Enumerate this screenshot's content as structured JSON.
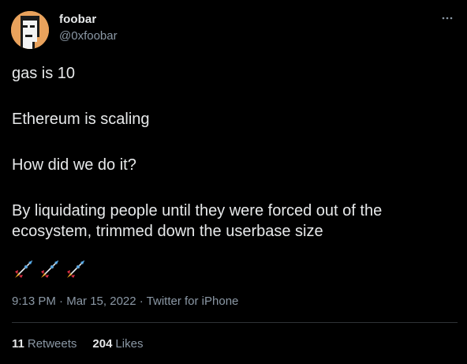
{
  "tweet": {
    "author": {
      "name": "foobar",
      "handle": "@0xfoobar",
      "avatar_icon": "pixel-punk-avatar-icon"
    },
    "more_icon": "more-horizontal-icon",
    "paragraphs": [
      "gas is 10",
      "Ethereum is scaling",
      "How did we do it?",
      "By liquidating people until they were forced out of the ecosystem, trimmed down the userbase size"
    ],
    "emojis": [
      "rocket-icon",
      "rocket-icon",
      "rocket-icon"
    ],
    "meta": {
      "time": "9:13 PM",
      "separator1": " · ",
      "date": "Mar 15, 2022",
      "separator2": " · ",
      "source": "Twitter for iPhone"
    },
    "stats": {
      "retweets_count": "11",
      "retweets_label": "Retweets",
      "likes_count": "204",
      "likes_label": "Likes"
    }
  },
  "colors": {
    "background": "#000000",
    "text_primary": "#e7e9ea",
    "text_secondary": "#8b98a5",
    "divider": "#2f3336",
    "avatar_bg": "#e9a25c"
  }
}
